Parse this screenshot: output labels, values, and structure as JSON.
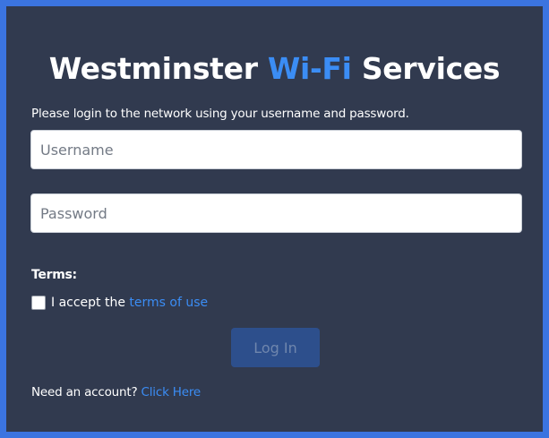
{
  "header": {
    "title_part1": "Westminster ",
    "title_accent": "Wi-Fi",
    "title_part2": " Services",
    "accent_color": "#3b8df5"
  },
  "form": {
    "intro_text": "Please login to the network using your username and password.",
    "username_placeholder": "Username",
    "username_value": "",
    "password_placeholder": "Password",
    "password_value": "",
    "terms_heading": "Terms:",
    "terms_checked": false,
    "terms_text": "I accept the ",
    "terms_link": "terms of use",
    "login_label": "Log In"
  },
  "footer": {
    "text": "Need an account? ",
    "link": "Click Here"
  },
  "colors": {
    "page_border": "#3b74e0",
    "panel_background": "#313a4f",
    "button_background": "#2d4f8c"
  }
}
